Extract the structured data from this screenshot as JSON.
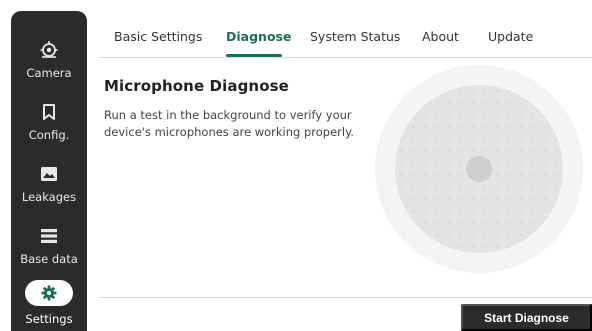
{
  "sidebar": {
    "items": [
      {
        "label": "Camera",
        "icon": "camera-icon"
      },
      {
        "label": "Config.",
        "icon": "bookmark-icon"
      },
      {
        "label": "Leakages",
        "icon": "image-icon"
      },
      {
        "label": "Base data",
        "icon": "list-icon"
      },
      {
        "label": "Settings",
        "icon": "gear-icon",
        "active": true
      }
    ]
  },
  "tabs": [
    {
      "label": "Basic Settings"
    },
    {
      "label": "Diagnose",
      "active": true
    },
    {
      "label": "System Status"
    },
    {
      "label": "About"
    },
    {
      "label": "Update"
    }
  ],
  "main": {
    "title": "Microphone Diagnose",
    "description": "Run a test in the background to verify your device's microphones are working properly.",
    "start_button": "Start Diagnose"
  },
  "colors": {
    "accent": "#1f6d57",
    "sidebar_bg": "#2b2b2b",
    "button_bg": "#2b2b2b"
  }
}
